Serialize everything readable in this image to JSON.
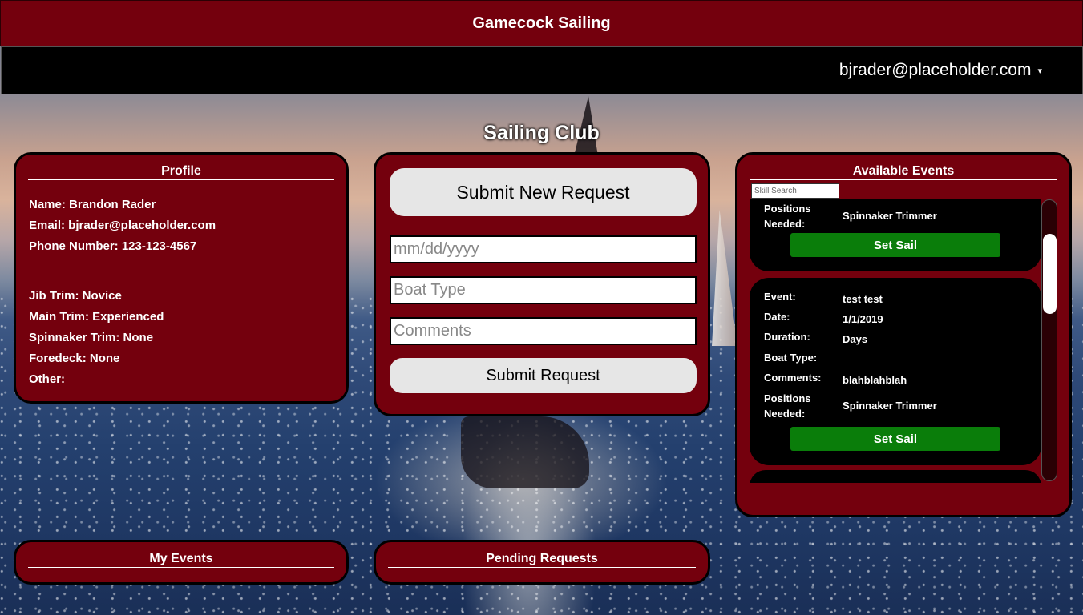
{
  "header": {
    "title": "Gamecock Sailing"
  },
  "navbar": {
    "user_email": "bjrader@placeholder.com",
    "caret": "▾"
  },
  "page": {
    "heading": "Sailing Club"
  },
  "profile": {
    "title": "Profile",
    "name": "Name: Brandon Rader",
    "email": "Email: bjrader@placeholder.com",
    "phone": "Phone Number: 123-123-4567",
    "skills": [
      "Jib Trim: Novice",
      "Main Trim: Experienced",
      "Spinnaker Trim: None",
      "Foredeck: None",
      "Other:"
    ]
  },
  "request_form": {
    "new_request_label": "Submit New Request",
    "date_placeholder": "mm/dd/yyyy",
    "boat_placeholder": "Boat Type",
    "comments_placeholder": "Comments",
    "submit_label": "Submit Request"
  },
  "available_events": {
    "title": "Available Events",
    "search_placeholder": "Skill Search",
    "set_sail_label": "Set Sail",
    "cards": [
      {
        "positions_label_1": "Positions",
        "positions_label_2": "Needed:",
        "positions_value": "Spinnaker Trimmer"
      },
      {
        "event_label": "Event:",
        "event_value": "test test",
        "date_label": "Date:",
        "date_value": "1/1/2019",
        "duration_label": "Duration:",
        "duration_value": "Days",
        "boat_label": "Boat Type:",
        "boat_value": "",
        "comments_label": "Comments:",
        "comments_value": "blahblahblah",
        "positions_label_1": "Positions",
        "positions_label_2": "Needed:",
        "positions_value": "Spinnaker Trimmer"
      }
    ]
  },
  "my_events": {
    "title": "My Events"
  },
  "pending_requests": {
    "title": "Pending Requests"
  },
  "colors": {
    "brand_maroon": "#74000d",
    "navbar_black": "#000000",
    "set_sail_green": "#0a7d0a"
  }
}
